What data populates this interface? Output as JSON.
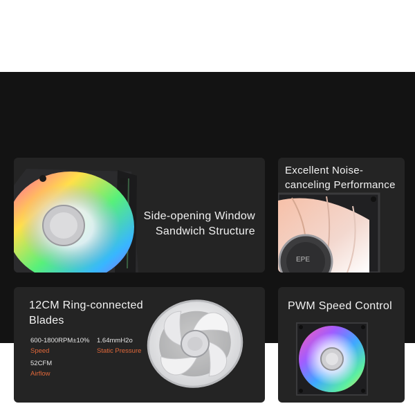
{
  "feature_side_window": {
    "line1": "Side-opening Window",
    "line2": "Sandwich Structure"
  },
  "feature_noise": {
    "line1": "Excellent Noise-",
    "line2": "canceling Performance"
  },
  "feature_blades": {
    "line1": "12CM Ring-connected",
    "line2": "Blades",
    "specs": [
      {
        "value": "600-1800RPM±10%",
        "label": "Speed"
      },
      {
        "value": "1.64mmH2o",
        "label": "Static Pressure"
      },
      {
        "value": "52CFM",
        "label": "Airflow"
      }
    ]
  },
  "feature_pwm": {
    "title": "PWM Speed Control"
  },
  "hub_logo_text": "EPE",
  "colors": {
    "banner_bg": "#131313",
    "card_bg": "#242424",
    "title_text": "#f2f2f2",
    "spec_label_accent": "#e0683a"
  }
}
